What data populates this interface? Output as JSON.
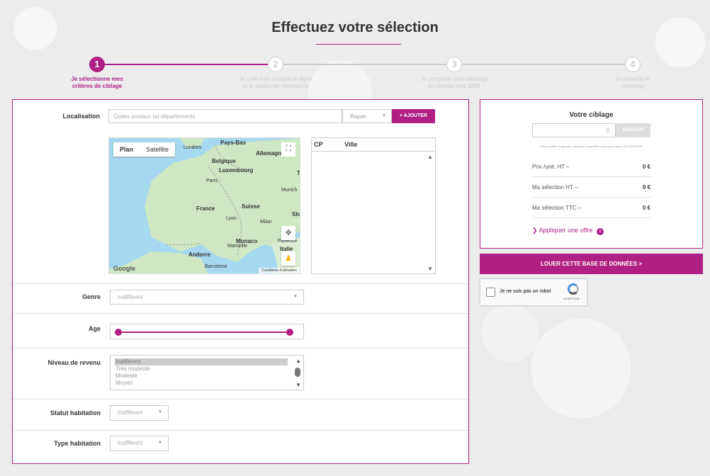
{
  "page": {
    "title": "Effectuez votre sélection"
  },
  "steps": [
    {
      "number": "1",
      "line1": "Je sélectionne mes",
      "line2": "critères de ciblage",
      "active": true
    },
    {
      "number": "2",
      "line1": "Je crée mon compte en ligne",
      "line2": "et je valide ma commande",
      "active": false
    },
    {
      "number": "3",
      "line1": "Je compose mon message",
      "line2": "et j'envoie mes SMS",
      "active": false
    },
    {
      "number": "4",
      "line1": "Je consulte le",
      "line2": "reporting",
      "active": false
    }
  ],
  "localisation": {
    "label": "Localisation",
    "placeholder": "Codes postaux ou départements",
    "rayon": "Rayon",
    "add_button": "+ AJOUTER"
  },
  "map": {
    "tab_plan": "Plan",
    "tab_satellite": "Satellite",
    "places": {
      "londres": "Londres",
      "pays_bas": "Pays-Bas",
      "belgique": "Belgique",
      "luxembourg": "Luxembourg",
      "allemagne": "Allemagne",
      "paris": "Paris",
      "munich": "Munich",
      "france": "France",
      "suisse": "Suisse",
      "lyon": "Lyon",
      "milan": "Milan",
      "monaco": "Monaco",
      "florence": "Florence",
      "italie": "Italie",
      "marseille": "Marseille",
      "andorre": "Andorre",
      "barcelone": "Barcelone",
      "slo": "Slo",
      "t": "T"
    },
    "google": "Google",
    "terms": "Conditions d'utilisation"
  },
  "cp_list": {
    "col_cp": "CP",
    "col_ville": "Ville"
  },
  "genre": {
    "label": "Genre",
    "value": "Indifférent"
  },
  "age": {
    "label": "Age",
    "min_fraction": 0.0,
    "max_fraction": 1.0
  },
  "revenu": {
    "label": "Niveau de revenu",
    "options": [
      "Indifférent",
      "Très modeste",
      "Modeste",
      "Moyen"
    ],
    "selected": "Indifférent"
  },
  "statut": {
    "label": "Statut habitation",
    "value": "Indifférent"
  },
  "type": {
    "label": "Type habitation",
    "value": "Indifférent"
  },
  "ciblage": {
    "title": "Votre ciblage",
    "quantity": "0",
    "modify_button": "MODIFIER",
    "note": "Pour modifier la quantité, saisissez la quantité voulue puis cliquez sur MODIFIER",
    "rows": [
      {
        "label": "Prix /unit. HT –",
        "value": "0 €"
      },
      {
        "label": "Ma sélection HT –",
        "value": "0 €"
      },
      {
        "label": "Ma sélection TTC –",
        "value": "0 €"
      }
    ],
    "offer_link": "Appliquer une offre"
  },
  "rent_button": "LOUER CETTE BASE DE DONNÉES  >",
  "captcha": {
    "text": "Je ne suis pas un robot",
    "brand": "reCAPTCHA"
  },
  "colors": {
    "accent": "#b01f83",
    "map_water": "#a6d8ef",
    "map_land": "#cfe8c4"
  }
}
